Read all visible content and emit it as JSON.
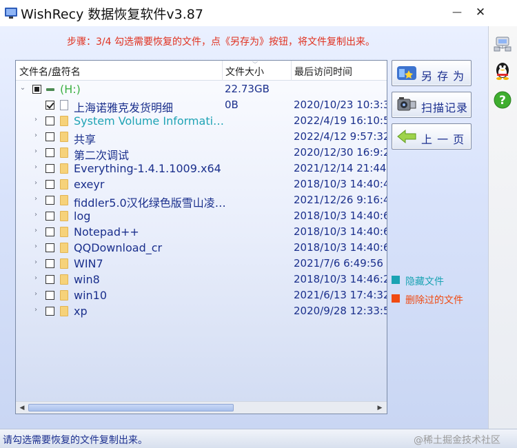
{
  "window": {
    "title": "WishRecy 数据恢复软件v3.87",
    "minimize_glyph": "—",
    "close_glyph": "✕"
  },
  "step_hint": "步骤：3/4 勾选需要恢复的文件，点《另存为》按钮，将文件复制出来。",
  "columns": {
    "name": "文件名/盘符名",
    "size": "文件大小",
    "date": "最后访问时间"
  },
  "tree": {
    "drive": {
      "label": "(H:)",
      "size": "22.73GB",
      "color": "#3cb043"
    },
    "rows": [
      {
        "name": "上海诺雅克发货明细",
        "size": "0B",
        "date": "2020/10/23 10:3:3",
        "checked": true,
        "type": "file",
        "color": "#1a2f8c",
        "expandable": false
      },
      {
        "name": "System Volume Informati…",
        "size": "",
        "date": "2022/4/19 16:10:5",
        "checked": false,
        "type": "folder",
        "color": "#1fa3b5",
        "expandable": true
      },
      {
        "name": "共享",
        "size": "",
        "date": "2022/4/12 9:57:32",
        "checked": false,
        "type": "folder",
        "color": "#1a2f8c",
        "expandable": true
      },
      {
        "name": "第二次调试",
        "size": "",
        "date": "2020/12/30 16:9:2",
        "checked": false,
        "type": "folder",
        "color": "#1a2f8c",
        "expandable": true
      },
      {
        "name": "Everything-1.4.1.1009.x64",
        "size": "",
        "date": "2021/12/14 21:44:",
        "checked": false,
        "type": "folder",
        "color": "#1a2f8c",
        "expandable": true
      },
      {
        "name": "exeyr",
        "size": "",
        "date": "2018/10/3 14:40:4",
        "checked": false,
        "type": "folder",
        "color": "#1a2f8c",
        "expandable": true
      },
      {
        "name": "fiddler5.0汉化绿色版雪山凌…",
        "size": "",
        "date": "2021/12/26 9:16:4",
        "checked": false,
        "type": "folder",
        "color": "#1a2f8c",
        "expandable": true
      },
      {
        "name": "log",
        "size": "",
        "date": "2018/10/3 14:40:6",
        "checked": false,
        "type": "folder",
        "color": "#1a2f8c",
        "expandable": true
      },
      {
        "name": "Notepad++",
        "size": "",
        "date": "2018/10/3 14:40:6",
        "checked": false,
        "type": "folder",
        "color": "#1a2f8c",
        "expandable": true
      },
      {
        "name": "QQDownload_cr",
        "size": "",
        "date": "2018/10/3 14:40:6",
        "checked": false,
        "type": "folder",
        "color": "#1a2f8c",
        "expandable": true
      },
      {
        "name": "WIN7",
        "size": "",
        "date": "2021/7/6 6:49:56",
        "checked": false,
        "type": "folder",
        "color": "#1a2f8c",
        "expandable": true
      },
      {
        "name": "win8",
        "size": "",
        "date": "2018/10/3 14:46:2",
        "checked": false,
        "type": "folder",
        "color": "#1a2f8c",
        "expandable": true
      },
      {
        "name": "win10",
        "size": "",
        "date": "2021/6/13 17:4:32",
        "checked": false,
        "type": "folder",
        "color": "#1a2f8c",
        "expandable": true
      },
      {
        "name": "xp",
        "size": "",
        "date": "2020/9/28 12:33:5",
        "checked": false,
        "type": "folder",
        "color": "#1a2f8c",
        "expandable": true
      }
    ]
  },
  "buttons": {
    "save_as": "另 存 为",
    "scan_records": "扫描记录",
    "prev_page": "上 一 页"
  },
  "legend": {
    "hidden": {
      "label": "隐藏文件",
      "color": "#1aa3b3"
    },
    "deleted": {
      "label": "删除过的文件",
      "color": "#f04a12"
    }
  },
  "status": {
    "text": "请勾选需要恢复的文件复制出来。",
    "watermark": "@稀土掘金技术社区"
  },
  "icons": {
    "app": "app-window-icon",
    "save": "save-as-icon",
    "scan": "scan-records-icon",
    "back": "back-arrow-icon",
    "side1": "network-icon",
    "side2": "qq-penguin-icon",
    "side3": "help-icon"
  }
}
